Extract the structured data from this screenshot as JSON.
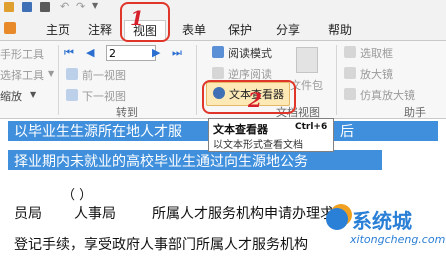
{
  "quick_access": [
    {
      "name": "folder-icon",
      "color": "#e0a030"
    },
    {
      "name": "save-icon",
      "color": "#3f6fb5"
    },
    {
      "name": "print-icon",
      "color": "#5a5a5a"
    },
    {
      "name": "undo-icon",
      "color": "#a0a0a0"
    },
    {
      "name": "redo-icon",
      "color": "#a0a0a0"
    }
  ],
  "tabs": [
    "主页",
    "注释",
    "视图",
    "表单",
    "保护",
    "分享",
    "帮助"
  ],
  "active_tab": "视图",
  "ribbon": {
    "tools": {
      "hand_tool": "手形工具",
      "select_tool": "选择工具",
      "zoom": "缩放"
    },
    "goto": {
      "page_input": "2",
      "prev_view": "前一视图",
      "next_view": "下一视图",
      "group_label": "转到"
    },
    "doc_view": {
      "read_mode": "阅读模式",
      "reverse_read": "逆序阅读",
      "text_viewer": "文本查看器",
      "file_label_1": "文件包",
      "group_label": "文档视图"
    },
    "assist": {
      "select_zoom": "选取框",
      "magnifier": "放大镜",
      "pan_zoom": "仿真放大镜",
      "group_label": "助手"
    }
  },
  "tooltip": {
    "title": "文本查看器",
    "shortcut": "Ctrl+6",
    "description": "以文本形式查看文档"
  },
  "markers": [
    "1",
    "2"
  ],
  "document": {
    "line1": "以毕业生生源所在地人才服",
    "line1_end": "后",
    "line2": "择业期内未就业的高校毕业生通过向生源地公务",
    "line3a": "员局",
    "line3_paren": "（    ）",
    "line3b": "人事局",
    "line3c": "所属人才服务机构申请办理求职",
    "line4": "登记手续，享受政府人事部门所属人才服务机构"
  },
  "watermark": {
    "brand": "系统城",
    "url": "xitongcheng.com"
  },
  "colors": {
    "highlight": "#3f8fdc",
    "annotation": "#e0362a",
    "brand": "#2a7fd6"
  }
}
